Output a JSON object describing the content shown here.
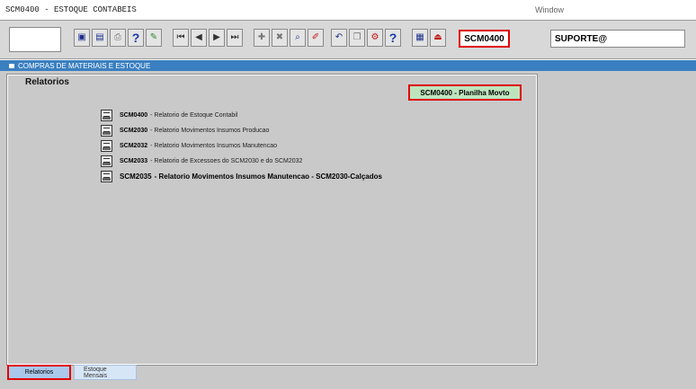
{
  "window": {
    "title": "SCM0400 - ESTOQUE CONTABEIS",
    "menu_label": "Window"
  },
  "toolbar": {
    "screen_code": "SCM0400",
    "user": "SUPORTE@",
    "icons_group1": [
      "save-icon",
      "form-icon",
      "print-icon",
      "help-key-icon",
      "wand-icon"
    ],
    "icons_group2": [
      "first-record-icon",
      "previous-record-icon",
      "next-record-icon",
      "last-record-icon"
    ],
    "icons_group3": [
      "insert-record-icon",
      "delete-record-icon",
      "query-icon",
      "edit-icon"
    ],
    "icons_group4": [
      "undo-icon",
      "copy-icon",
      "tools-icon",
      "help-icon"
    ],
    "icons_group5": [
      "calculator-icon",
      "exit-icon"
    ]
  },
  "module": {
    "title": "COMPRAS DE MATERIAIS E ESTOQUE"
  },
  "panel": {
    "title": "Relatorios",
    "action_button": "SCM0400 - Planilha Movto"
  },
  "reports": [
    {
      "code": "SCM0400",
      "text": "- Relatorio de Estoque Contabil",
      "emphasis": false
    },
    {
      "code": "SCM2030",
      "text": "- Relatorio Movimentos Insumos Producao",
      "emphasis": false
    },
    {
      "code": "SCM2032",
      "text": "- Relatorio Movimentos Insumos Manutencao",
      "emphasis": false
    },
    {
      "code": "SCM2033",
      "text": "- Relatorio de Excessoes do SCM2030 e do SCM2032",
      "emphasis": false
    },
    {
      "code": "SCM2035",
      "text": "- Relatorio Movimentos Insumos Manutencao - SCM2030-Calçados",
      "emphasis": true
    }
  ],
  "tabs": [
    {
      "label": "Relatorios",
      "active": true
    },
    {
      "label": "Estoque Mensais",
      "active": false
    }
  ],
  "colors": {
    "module_bar": "#3a7fc0",
    "highlight_border": "#e00000",
    "action_button_bg": "#bde5bd",
    "canvas": "#c9c9c9"
  }
}
